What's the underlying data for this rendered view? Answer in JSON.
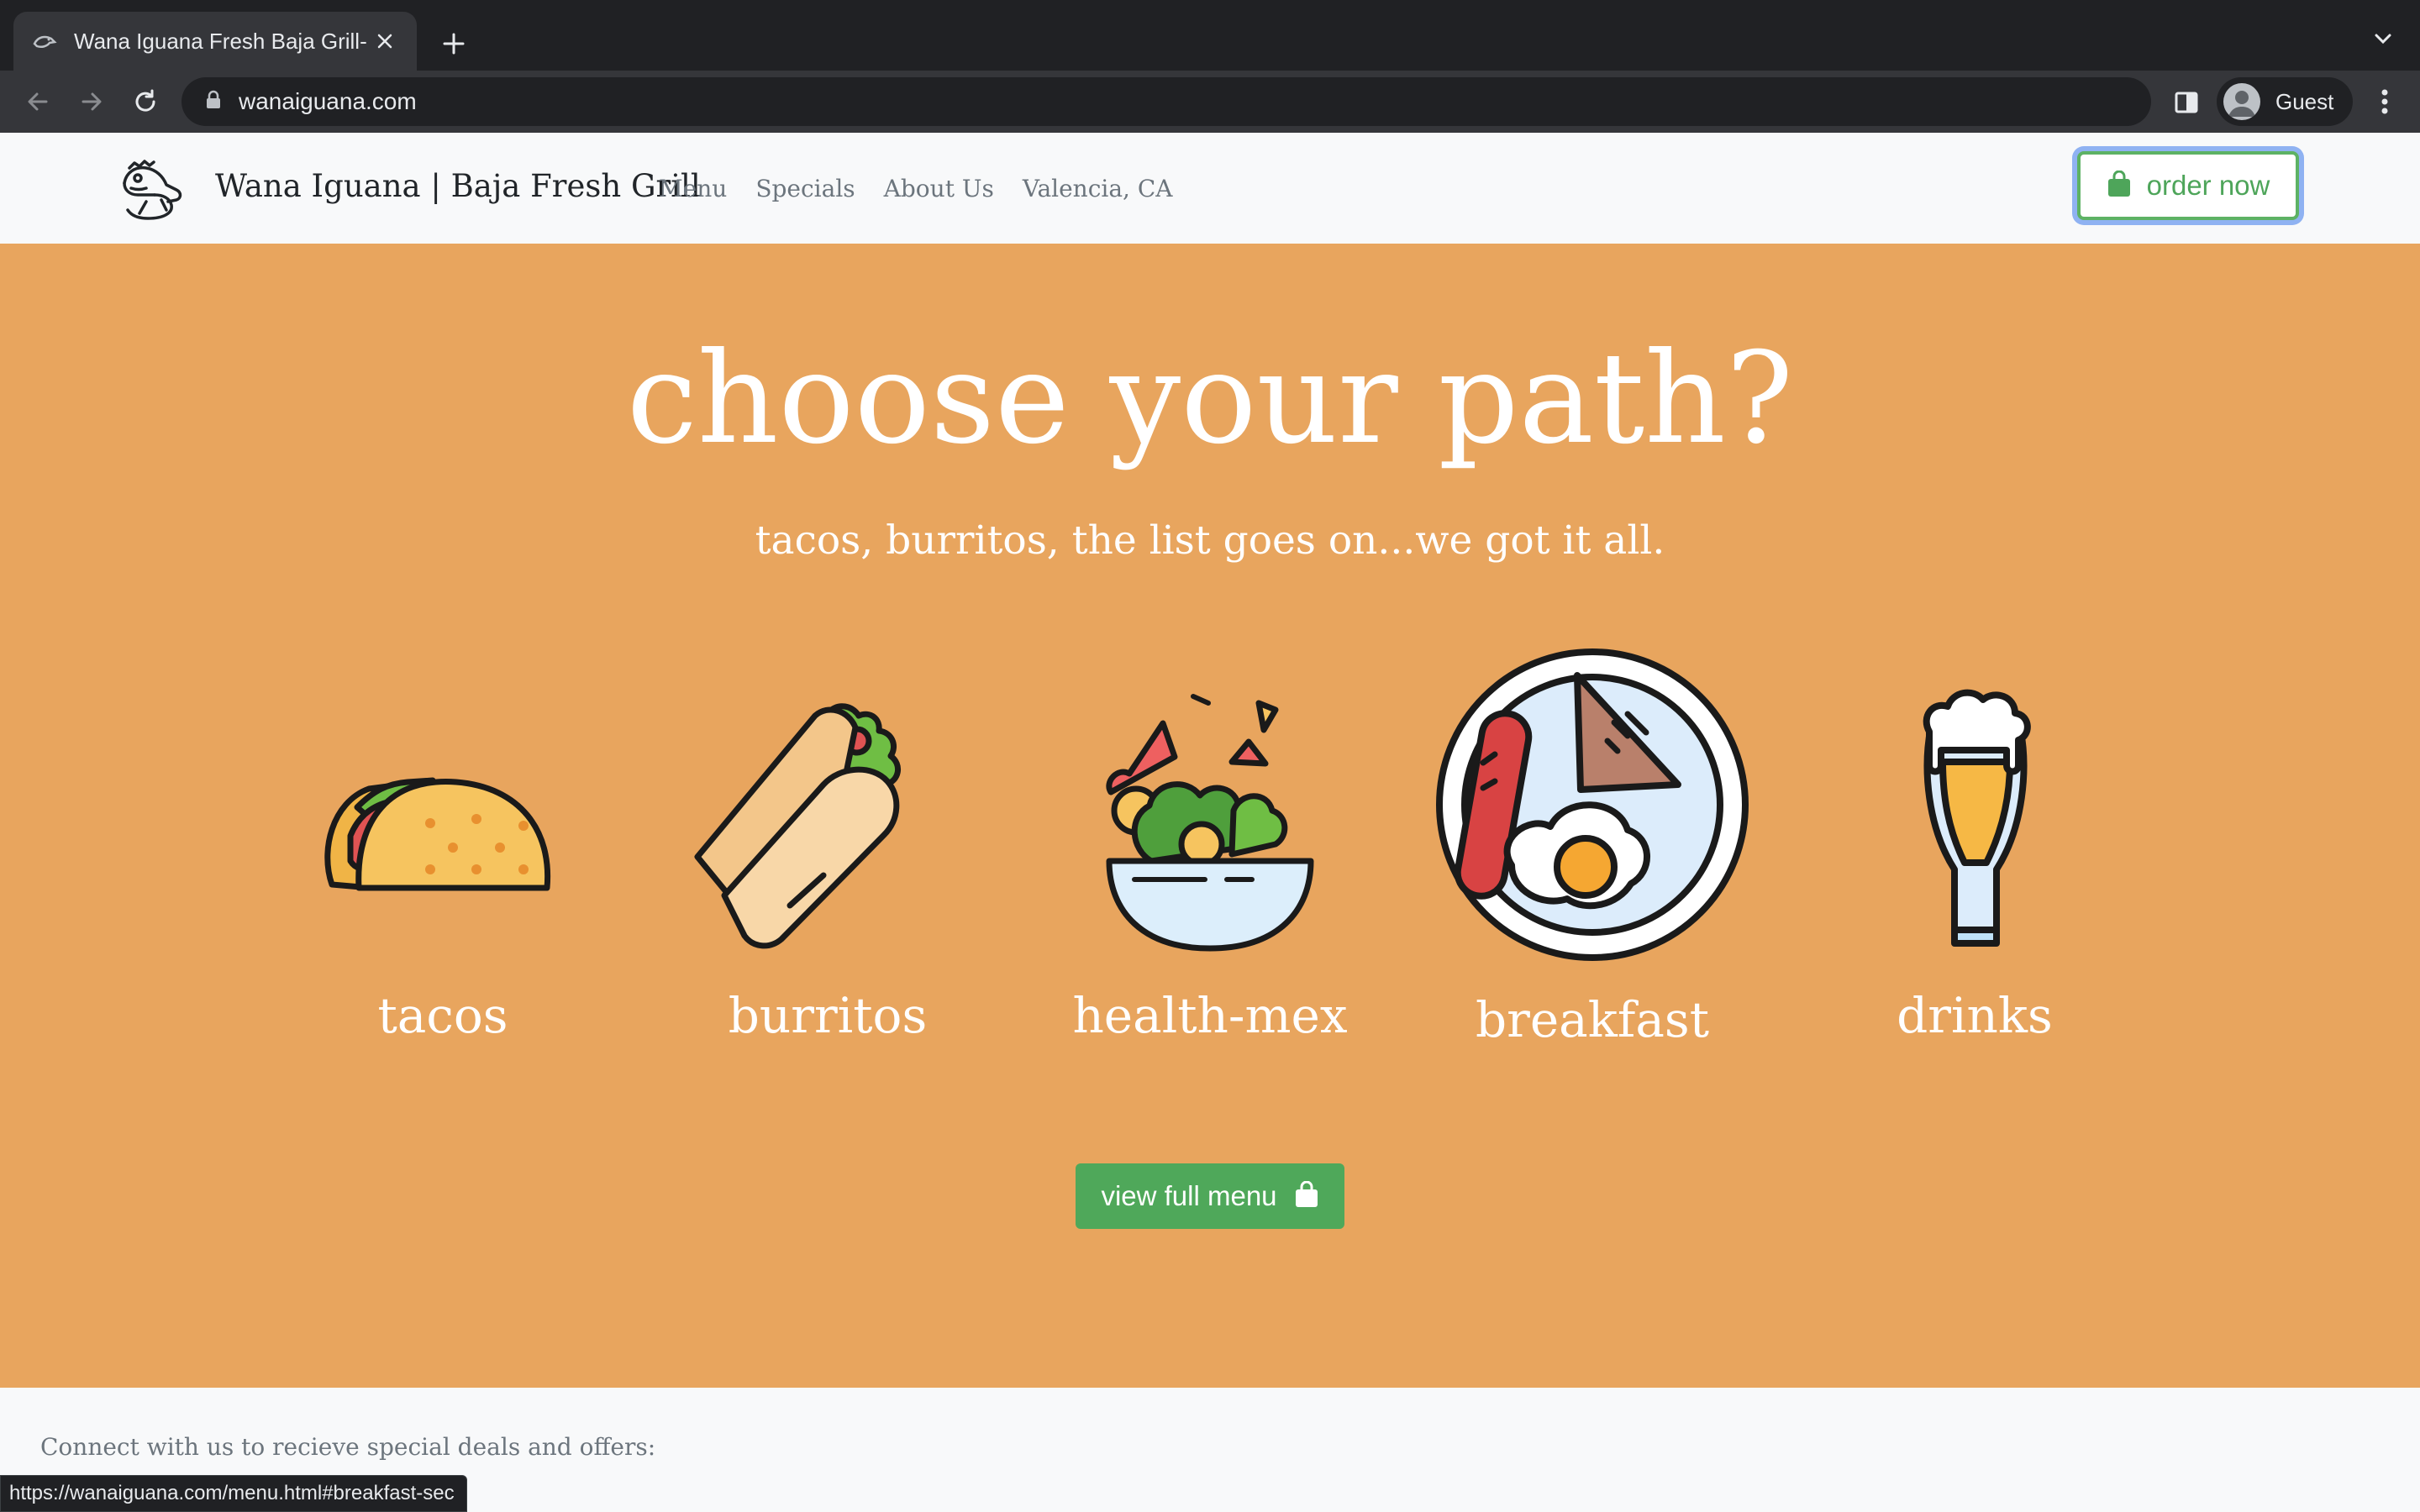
{
  "browser": {
    "tab_title": "Wana Iguana Fresh Baja Grill- V",
    "url": "wanaiguana.com",
    "profile_label": "Guest",
    "status_url": "https://wanaiguana.com/menu.html#breakfast-sec"
  },
  "header": {
    "brand": "Wana Iguana | Baja Fresh Grill",
    "nav": [
      "Menu",
      "Specials",
      "About Us",
      "Valencia, CA"
    ],
    "order_button": "order now"
  },
  "hero": {
    "title": "choose your path?",
    "subtitle": "tacos, burritos, the list goes on...we got it all.",
    "categories": [
      {
        "label": "tacos",
        "icon": "taco-icon"
      },
      {
        "label": "burritos",
        "icon": "burrito-icon"
      },
      {
        "label": "health-mex",
        "icon": "salad-bowl-icon"
      },
      {
        "label": "breakfast",
        "icon": "breakfast-plate-icon"
      },
      {
        "label": "drinks",
        "icon": "beer-glass-icon"
      }
    ],
    "menu_button": "view full menu"
  },
  "footer": {
    "text": "Connect with us to recieve special deals and offers:"
  },
  "colors": {
    "hero_bg": "#e8a55e",
    "accent_green": "#4fa85a",
    "focus_ring": "#8fb2f2",
    "chrome_dark": "#202124"
  }
}
